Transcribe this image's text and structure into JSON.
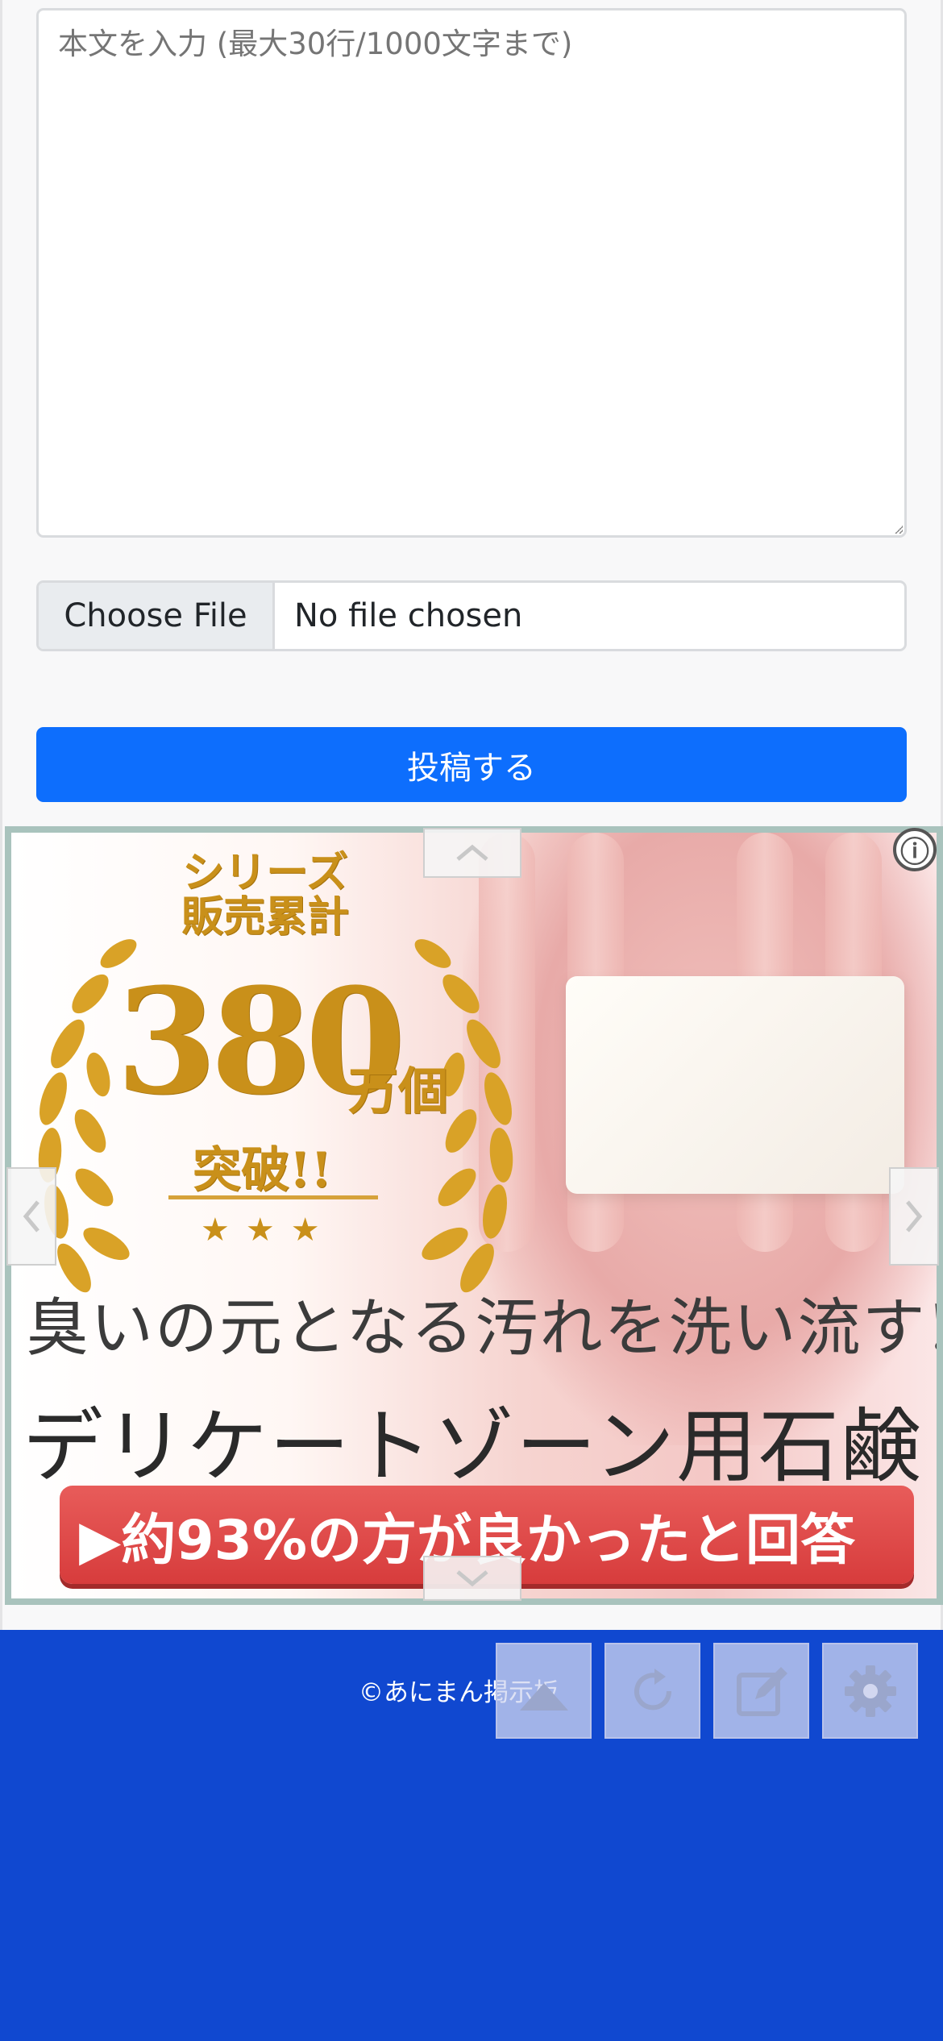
{
  "form": {
    "body_placeholder": "本文を入力 (最大30行/1000文字まで)",
    "file_button_label": "Choose File",
    "file_status": "No file chosen",
    "submit_label": "投稿する"
  },
  "ad": {
    "series_text": "シリーズ\n販売累計",
    "big_number": "380",
    "unit": "万個",
    "breakthrough": "突破!!",
    "stars": "★★★",
    "copy_line1": "臭いの元となる汚れを洗い流す!",
    "copy_line2": "デリケートゾーン用石鹸",
    "cta": "▶約93%の方が良かったと回答",
    "info_icon": "ⓘ",
    "colors": {
      "gold": "#c9901a",
      "cta": "#d73c3c",
      "border": "#a9c3bd"
    }
  },
  "footer": {
    "copyright": "©あにまん掲示板",
    "background": "#1048d0"
  },
  "toolbar": {
    "icons": [
      "scroll-top-icon",
      "reload-icon",
      "edit-icon",
      "settings-icon"
    ]
  }
}
